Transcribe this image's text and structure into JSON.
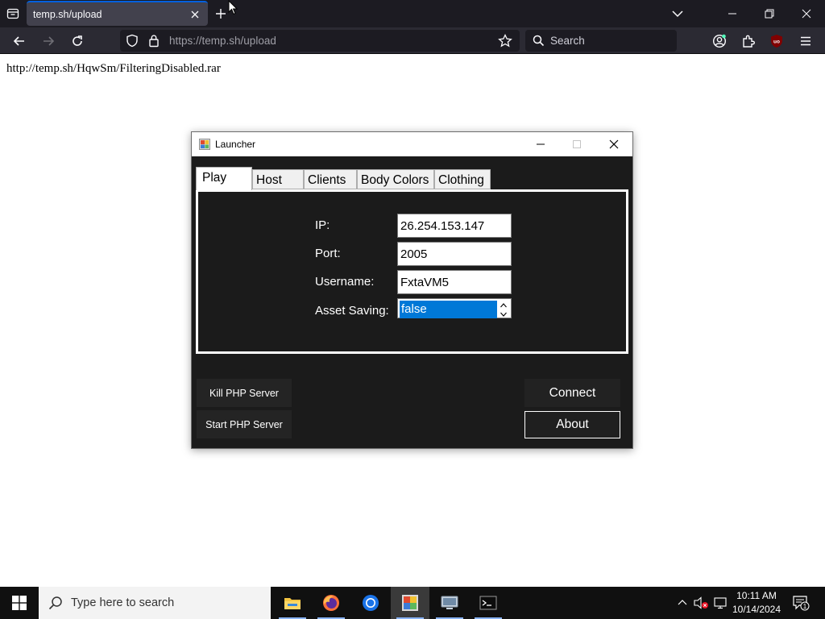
{
  "browser": {
    "tab_title": "temp.sh/upload",
    "url_host": "https://temp.sh",
    "url_path": "/upload",
    "search_placeholder": "Search",
    "ublock_badge": "uo"
  },
  "page": {
    "link_text": "http://temp.sh/HqwSm/FilteringDisabled.rar"
  },
  "launcher": {
    "title": "Launcher",
    "tabs": [
      "Play",
      "Host",
      "Clients",
      "Body Colors",
      "Clothing"
    ],
    "fields": {
      "ip_label": "IP:",
      "ip_value": "26.254.153.147",
      "port_label": "Port:",
      "port_value": "2005",
      "username_label": "Username:",
      "username_value": "FxtaVM5",
      "asset_label": "Asset Saving:",
      "asset_value": "false"
    },
    "buttons": {
      "kill_php": "Kill PHP Server",
      "start_php": "Start PHP Server",
      "connect": "Connect",
      "about": "About"
    }
  },
  "taskbar": {
    "search_placeholder": "Type here to search",
    "time": "10:11 AM",
    "date": "10/14/2024",
    "notification_count": "1",
    "apps": [
      "file-explorer-icon",
      "firefox-icon",
      "chrome-icon",
      "launcher-app-icon",
      "remote-desktop-icon",
      "terminal-icon"
    ]
  },
  "colors": {
    "accent": "#0078d7",
    "browser_tab_accent": "#0060df",
    "window_bg": "#1b1b1b"
  }
}
